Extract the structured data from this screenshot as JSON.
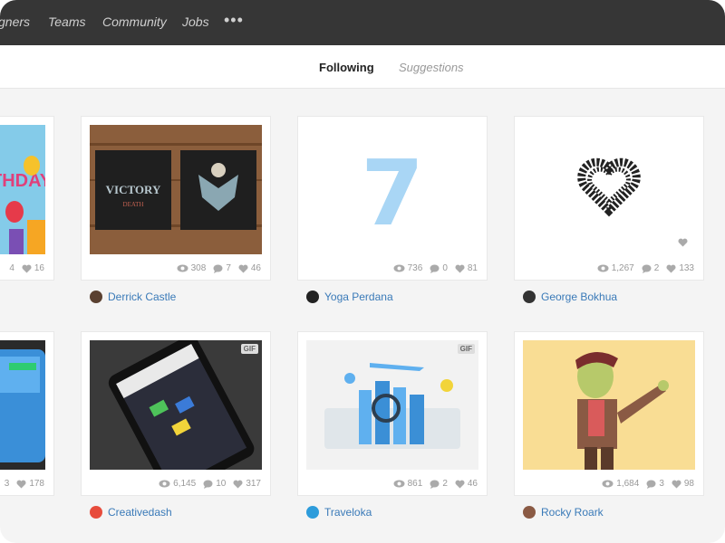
{
  "topnav": {
    "items": [
      "gners",
      "Teams",
      "Community",
      "Jobs"
    ],
    "more": "•••"
  },
  "subnav": {
    "following": "Following",
    "suggestions": "Suggestions"
  },
  "cards": [
    {
      "views": "4",
      "comments": "",
      "likes": "16",
      "author": ""
    },
    {
      "views": "308",
      "comments": "7",
      "likes": "46",
      "author": "Derrick Castle"
    },
    {
      "views": "736",
      "comments": "0",
      "likes": "81",
      "author": "Yoga Perdana"
    },
    {
      "views": "1,267",
      "comments": "2",
      "likes": "133",
      "author": "George Bokhua"
    },
    {
      "views": "3",
      "comments": "",
      "likes": "178",
      "author": ""
    },
    {
      "views": "6,145",
      "comments": "10",
      "likes": "317",
      "author": "Creativedash"
    },
    {
      "views": "861",
      "comments": "2",
      "likes": "46",
      "author": "Traveloka"
    },
    {
      "views": "1,684",
      "comments": "3",
      "likes": "98",
      "author": "Rocky Roark"
    }
  ],
  "badges": {
    "gif": "GIF"
  },
  "artwork_text": {
    "birthday": "THDAY",
    "victory": "VICTORY",
    "death": "DEATH",
    "seven": "7"
  },
  "colors": {
    "link": "#3a7ab8",
    "nav_bg": "#363636"
  }
}
